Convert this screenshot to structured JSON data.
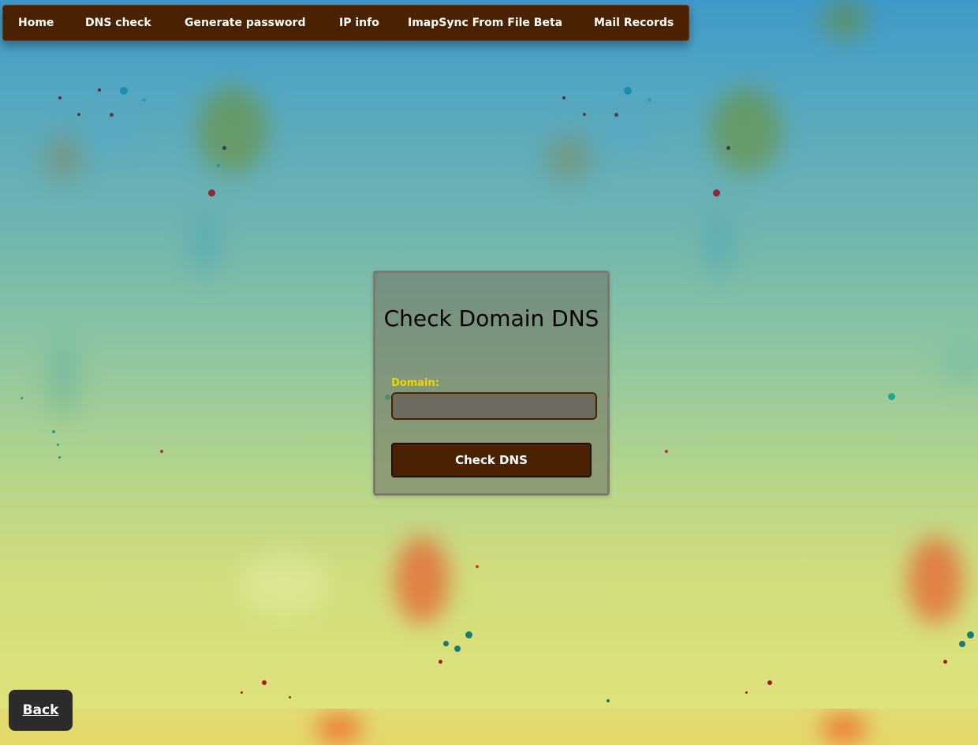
{
  "nav": {
    "items": [
      {
        "label": "Home"
      },
      {
        "label": "DNS check"
      },
      {
        "label": "Generate password"
      },
      {
        "label": "IP info"
      },
      {
        "label": "ImapSync From File Beta"
      },
      {
        "label": "Mail Records"
      }
    ]
  },
  "form": {
    "title": "Check Domain DNS",
    "domain_label": "Domain:",
    "domain_value": "",
    "submit_label": "Check DNS"
  },
  "back": {
    "label": "Back"
  },
  "colors": {
    "nav_bg": "#4a2202",
    "label_yellow": "#f2d400",
    "back_bg": "#2b2b2b"
  }
}
